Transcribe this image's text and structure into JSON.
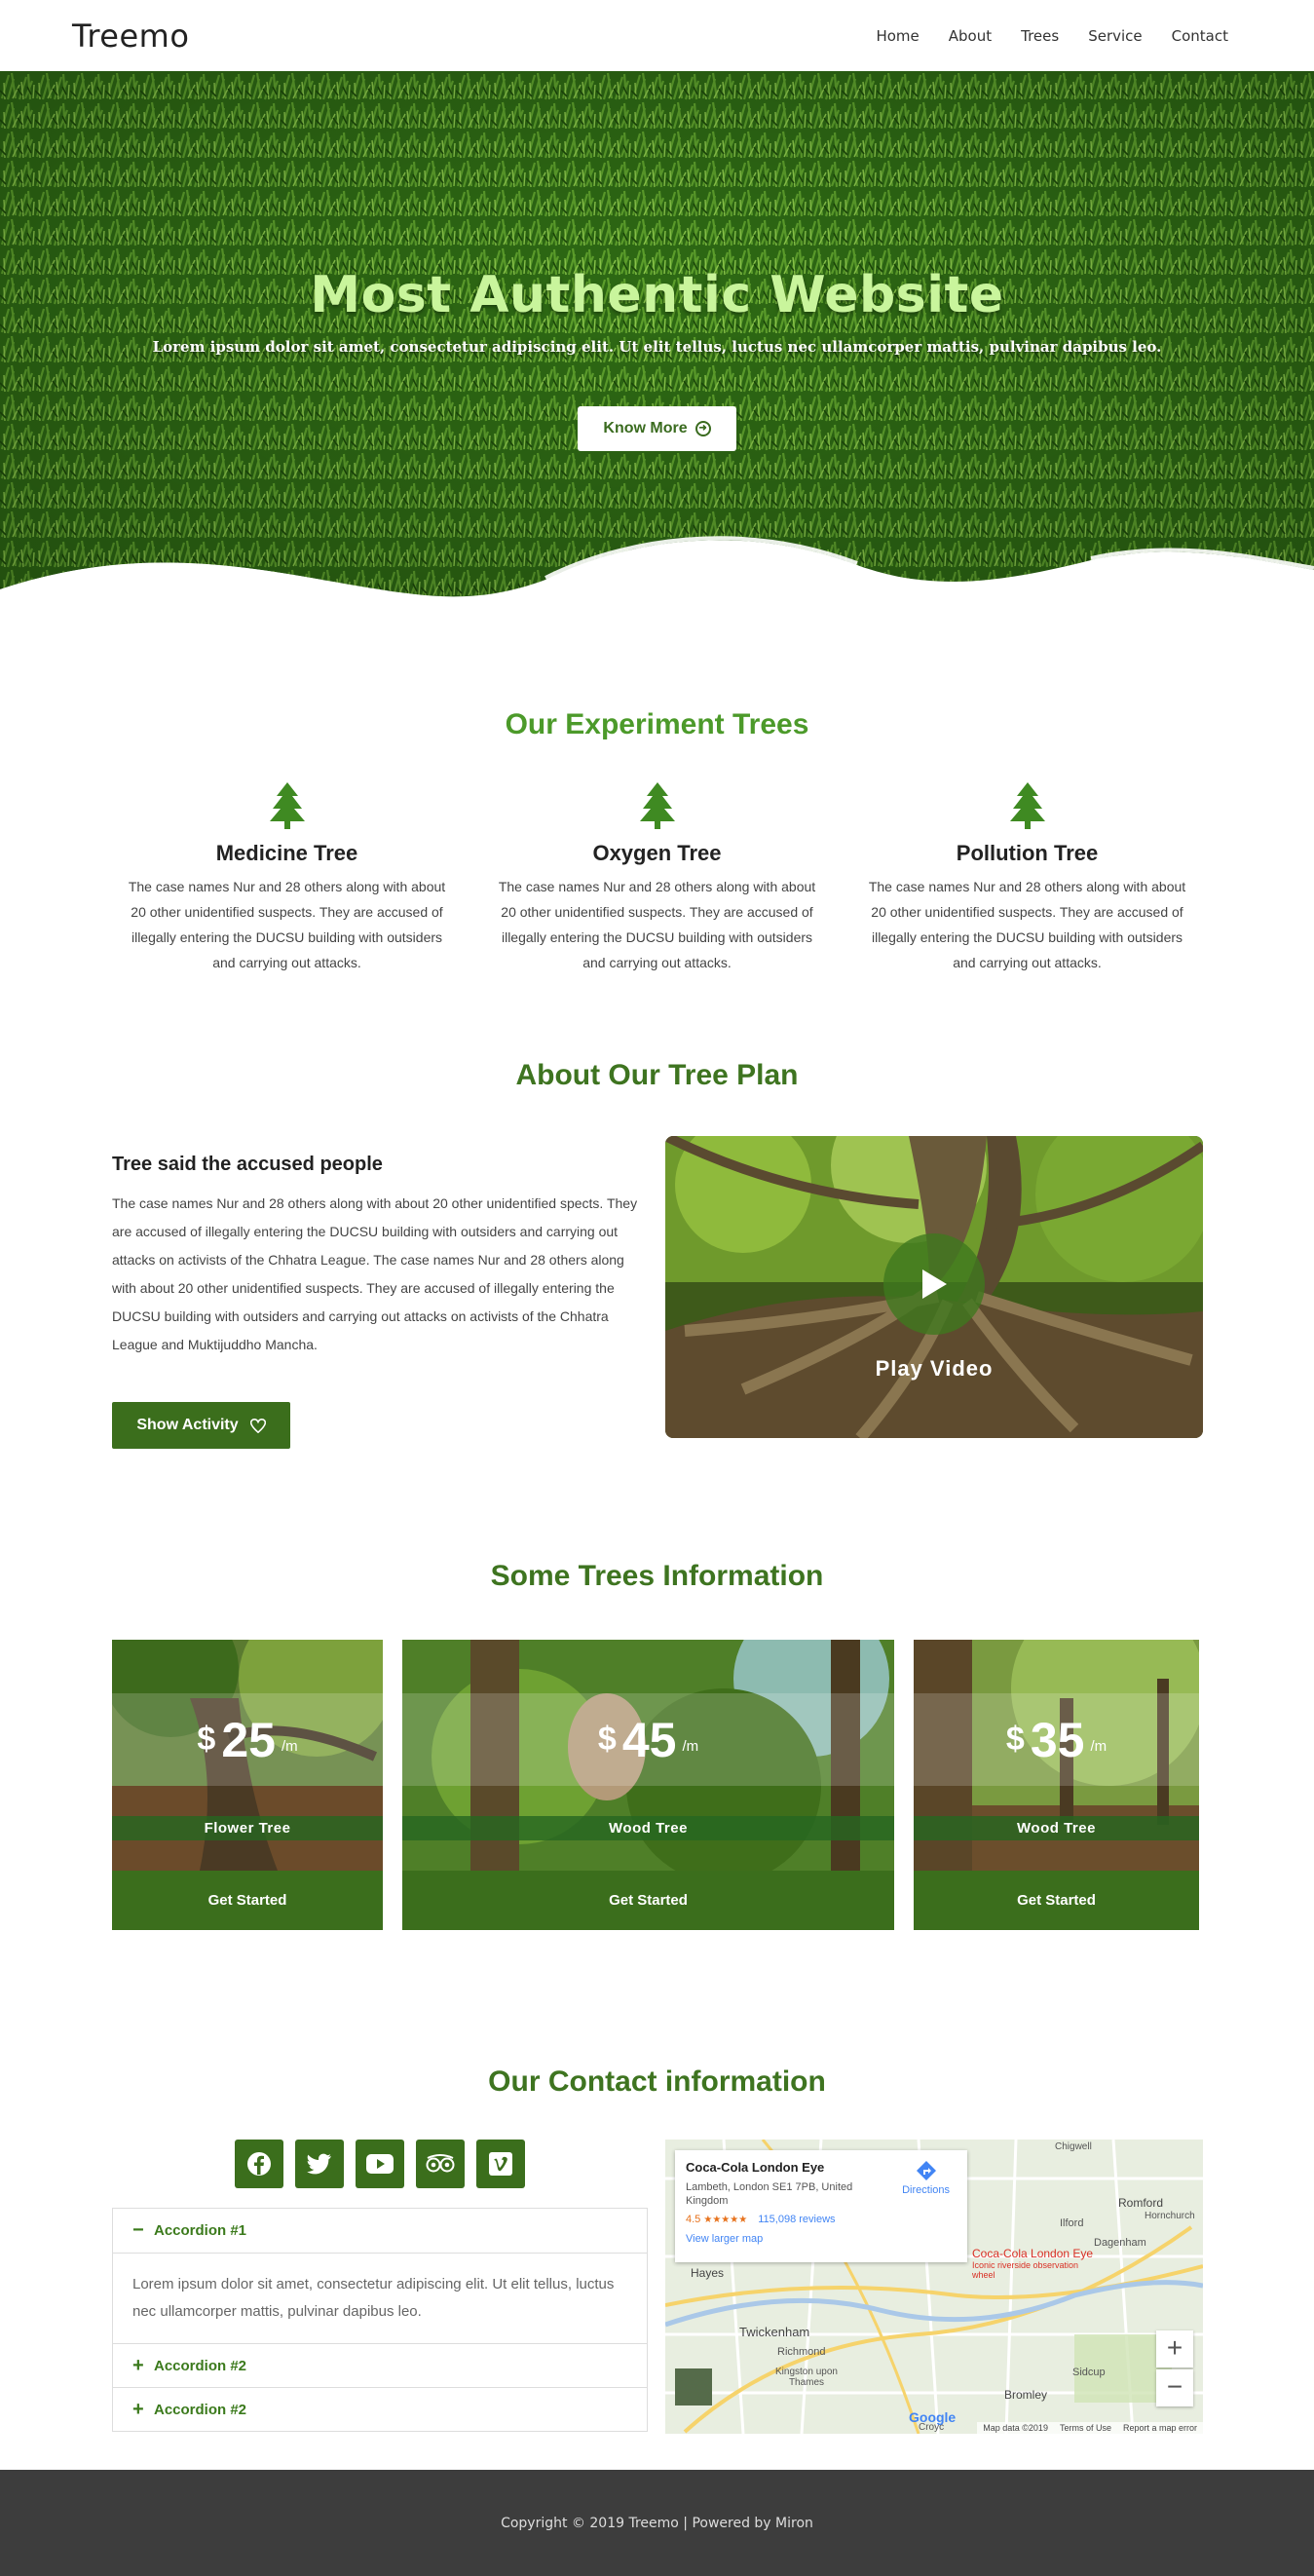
{
  "nav": {
    "logo": "Treemo",
    "items": [
      "Home",
      "About",
      "Trees",
      "Service",
      "Contact"
    ]
  },
  "hero": {
    "title": "Most Authentic Website",
    "subtitle": "Lorem ipsum dolor sit amet, consectetur adipiscing elit. Ut elit tellus, luctus nec ullamcorper mattis, pulvinar dapibus leo.",
    "button": "Know More"
  },
  "experiment": {
    "title": "Our Experiment Trees",
    "items": [
      {
        "name": "Medicine Tree",
        "text": "The case names Nur and 28 others along with about 20 other unidentified suspects. They are accused of illegally entering the DUCSU building with outsiders and carrying out attacks."
      },
      {
        "name": "Oxygen Tree",
        "text": "The case names Nur and 28 others along with about 20 other unidentified suspects. They are accused of illegally entering the DUCSU building with outsiders and carrying out attacks."
      },
      {
        "name": "Pollution Tree",
        "text": "The case names Nur and 28 others along with about 20 other unidentified suspects. They are accused of illegally entering the DUCSU building with outsiders and carrying out attacks."
      }
    ]
  },
  "about": {
    "title": "About Our Tree Plan",
    "heading": "Tree said the accused people",
    "text": "The case names Nur and 28 others along with about 20 other unidentified spects. They are accused of illegally entering the DUCSU building with outsiders and carrying out attacks on activists of the Chhatra League. The case names Nur and 28 others along with about 20 other unidentified suspects. They are accused of illegally entering the DUCSU building with outsiders and carrying out attacks on activists of the Chhatra League and Muktijuddho Mancha.",
    "button": "Show Activity",
    "video_label": "Play Video"
  },
  "pricing": {
    "title": "Some Trees Information",
    "cards": [
      {
        "currency": "$",
        "price": "25",
        "unit": "/m",
        "name": "Flower Tree",
        "cta": "Get Started"
      },
      {
        "currency": "$",
        "price": "45",
        "unit": "/m",
        "name": "Wood Tree",
        "cta": "Get Started"
      },
      {
        "currency": "$",
        "price": "35",
        "unit": "/m",
        "name": "Wood Tree",
        "cta": "Get Started"
      }
    ]
  },
  "contact": {
    "title": "Our Contact information",
    "socials": [
      "facebook-icon",
      "twitter-icon",
      "youtube-icon",
      "tripadvisor-icon",
      "vimeo-icon"
    ],
    "accordion": [
      {
        "label": "Accordion #1",
        "sign": "−",
        "body": "Lorem ipsum dolor sit amet, consectetur adipiscing elit. Ut elit tellus, luctus nec ullamcorper mattis, pulvinar dapibus leo."
      },
      {
        "label": "Accordion #2",
        "sign": "+"
      },
      {
        "label": "Accordion #2",
        "sign": "+"
      }
    ],
    "map": {
      "place": "Coca-Cola London Eye",
      "address": "Lambeth, London SE1 7PB, United Kingdom",
      "rating": "4.5",
      "stars": "★★★★★",
      "reviews": "115,098 reviews",
      "larger": "View larger map",
      "directions": "Directions",
      "pin_label": "Coca-Cola London Eye",
      "pin_sub": "Iconic riverside observation wheel",
      "places": [
        "Chigwell",
        "Romford",
        "Ilford",
        "Hornchurch",
        "Dagenham",
        "Hayes",
        "Richmond",
        "Twickenham",
        "Kingston upon Thames",
        "Sidcup",
        "Bromley",
        "Croyc"
      ],
      "google": "Google",
      "attrib": "Map data ©2019",
      "terms": "Terms of Use",
      "report": "Report a map error",
      "zoom_in": "+",
      "zoom_out": "−"
    }
  },
  "footer": {
    "text": "Copyright © 2019 Treemo | Powered by Miron"
  }
}
